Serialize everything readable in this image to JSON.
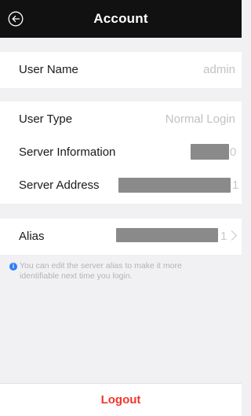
{
  "header": {
    "title": "Account",
    "back_icon": "back-arrow-circle-icon"
  },
  "rows": {
    "user_name": {
      "label": "User Name",
      "value": "admin"
    },
    "user_type": {
      "label": "User Type",
      "value": "Normal Login"
    },
    "server_information": {
      "label": "Server Information",
      "tail": "0"
    },
    "server_address": {
      "label": "Server Address",
      "tail": "1"
    },
    "alias": {
      "label": "Alias",
      "tail": "1"
    }
  },
  "hint": {
    "line1": "You can edit the server alias to make it more",
    "line2": "identifiable next time you login."
  },
  "footer": {
    "logout_label": "Logout"
  },
  "colors": {
    "header_bg": "#111111",
    "page_bg": "#f1f1f3",
    "logout_text": "#f2362b",
    "info_icon": "#2f7df6",
    "redaction": "#8a8a8a"
  }
}
